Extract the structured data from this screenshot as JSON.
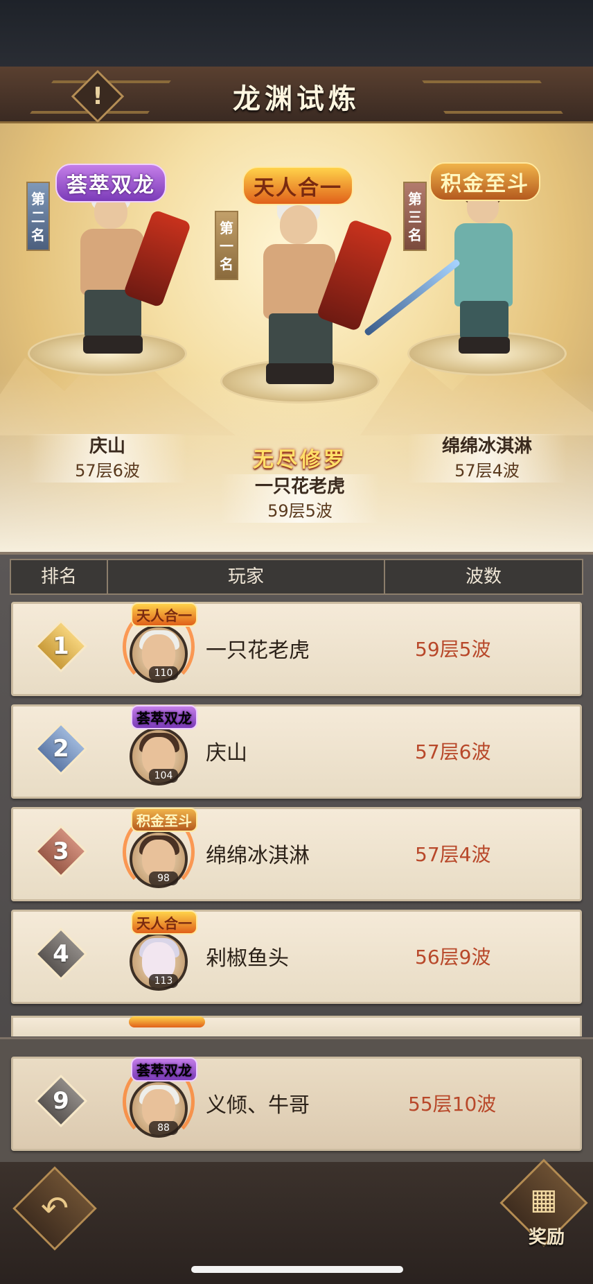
{
  "header": {
    "title": "龙渊试炼",
    "info_icon": "!"
  },
  "podium": [
    {
      "place_banner": "第二名",
      "title_badge": "荟萃双龙",
      "name": "庆山",
      "score": "57层6波"
    },
    {
      "place_banner": "第一名",
      "title_badge": "天人合一",
      "special_title": "无尽修罗",
      "name": "一只花老虎",
      "score": "59层5波"
    },
    {
      "place_banner": "第三名",
      "title_badge": "积金至斗",
      "name": "绵绵冰淇淋",
      "score": "57层4波"
    }
  ],
  "table": {
    "headers": {
      "rank": "排名",
      "player": "玩家",
      "waves": "波数"
    },
    "rows": [
      {
        "rank": "1",
        "badge": "天人合一",
        "level": "110",
        "name": "一只花老虎",
        "score": "59层5波"
      },
      {
        "rank": "2",
        "badge": "荟萃双龙",
        "level": "104",
        "name": "庆山",
        "score": "57层6波"
      },
      {
        "rank": "3",
        "badge": "积金至斗",
        "level": "98",
        "name": "绵绵冰淇淋",
        "score": "57层4波"
      },
      {
        "rank": "4",
        "badge": "天人合一",
        "level": "113",
        "name": "剁椒鱼头",
        "score": "56层9波"
      }
    ],
    "self": {
      "rank": "9",
      "badge": "荟萃双龙",
      "level": "88",
      "name": "义倾、牛哥",
      "score": "55层10波"
    }
  },
  "footer": {
    "back_icon": "back-arrow-icon",
    "reward_label": "奖励",
    "reward_icon": "reward-chest-icon"
  }
}
